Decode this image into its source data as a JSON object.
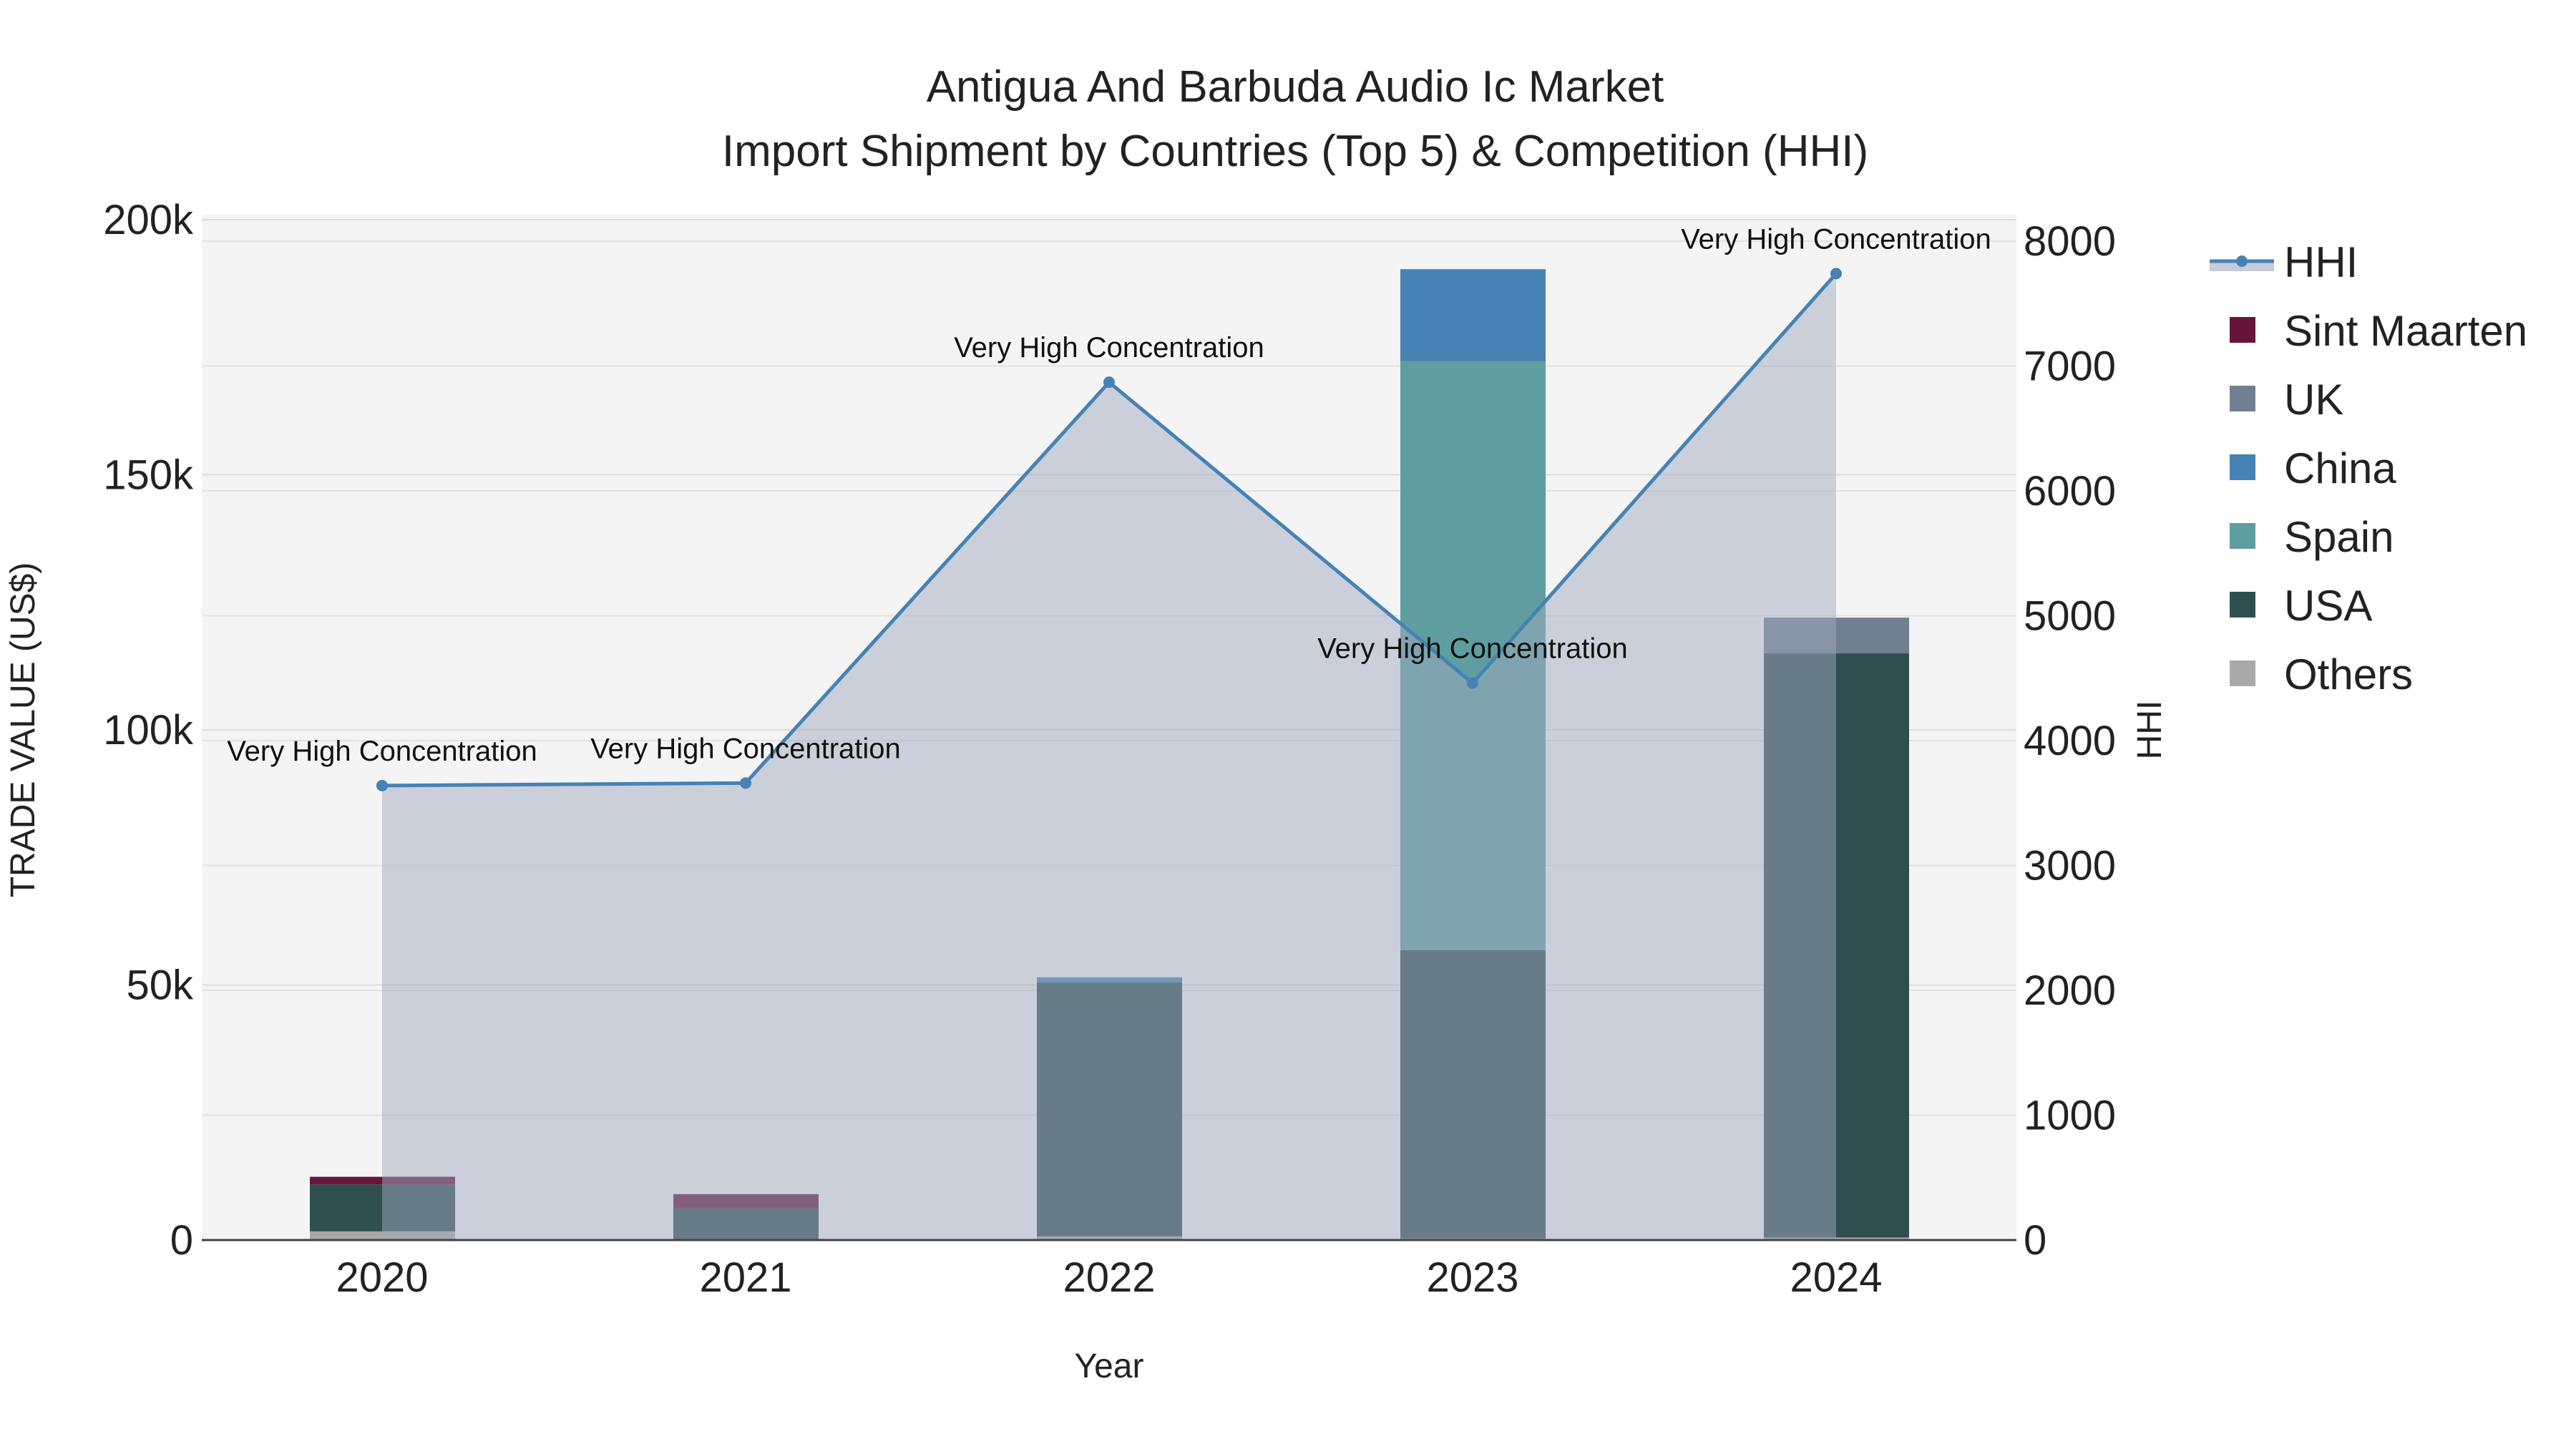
{
  "chart_data": {
    "type": "bar",
    "title": "Antigua And Barbuda Audio Ic Market",
    "subtitle": "Import Shipment by Countries (Top 5) & Competition (HHI)",
    "xlabel": "Year",
    "ylabel": "TRADE VALUE (US$)",
    "y2label": "HHI",
    "categories": [
      "2020",
      "2021",
      "2022",
      "2023",
      "2024"
    ],
    "ylim": [
      0,
      200000
    ],
    "y2lim": [
      0,
      8000
    ],
    "yticks": [
      {
        "v": 0,
        "label": "0"
      },
      {
        "v": 50000,
        "label": "50k"
      },
      {
        "v": 100000,
        "label": "100k"
      },
      {
        "v": 150000,
        "label": "150k"
      },
      {
        "v": 200000,
        "label": "200k"
      }
    ],
    "y2ticks": [
      {
        "v": 0,
        "label": "0"
      },
      {
        "v": 1000,
        "label": "1000"
      },
      {
        "v": 2000,
        "label": "2000"
      },
      {
        "v": 3000,
        "label": "3000"
      },
      {
        "v": 4000,
        "label": "4000"
      },
      {
        "v": 5000,
        "label": "5000"
      },
      {
        "v": 6000,
        "label": "6000"
      },
      {
        "v": 7000,
        "label": "7000"
      },
      {
        "v": 8000,
        "label": "8000"
      }
    ],
    "series": [
      {
        "name": "Others",
        "color": "#a9a9a9",
        "values": [
          1700,
          0,
          700,
          300,
          500
        ]
      },
      {
        "name": "USA",
        "color": "#2f4f4f",
        "values": [
          9200,
          6200,
          49800,
          56500,
          114500
        ]
      },
      {
        "name": "Spain",
        "color": "#5f9ea0",
        "values": [
          0,
          0,
          0,
          115500,
          0
        ]
      },
      {
        "name": "China",
        "color": "#4682b4",
        "values": [
          0,
          0,
          1000,
          18000,
          0
        ]
      },
      {
        "name": "UK",
        "color": "#708090",
        "values": [
          0,
          0,
          0,
          0,
          7000
        ]
      },
      {
        "name": "Sint Maarten",
        "color": "#65163a",
        "values": [
          1500,
          2800,
          0,
          0,
          0
        ]
      }
    ],
    "hhi": {
      "name": "HHI",
      "color": "#4682b4",
      "values": [
        3640,
        3660,
        6870,
        4460,
        7740
      ],
      "annotations": [
        "Very High Concentration",
        "Very High Concentration",
        "Very High Concentration",
        "Very High Concentration",
        "Very High Concentration"
      ]
    },
    "legend_order": [
      "HHI",
      "Sint Maarten",
      "UK",
      "China",
      "Spain",
      "USA",
      "Others"
    ],
    "legend_placement": "right"
  }
}
